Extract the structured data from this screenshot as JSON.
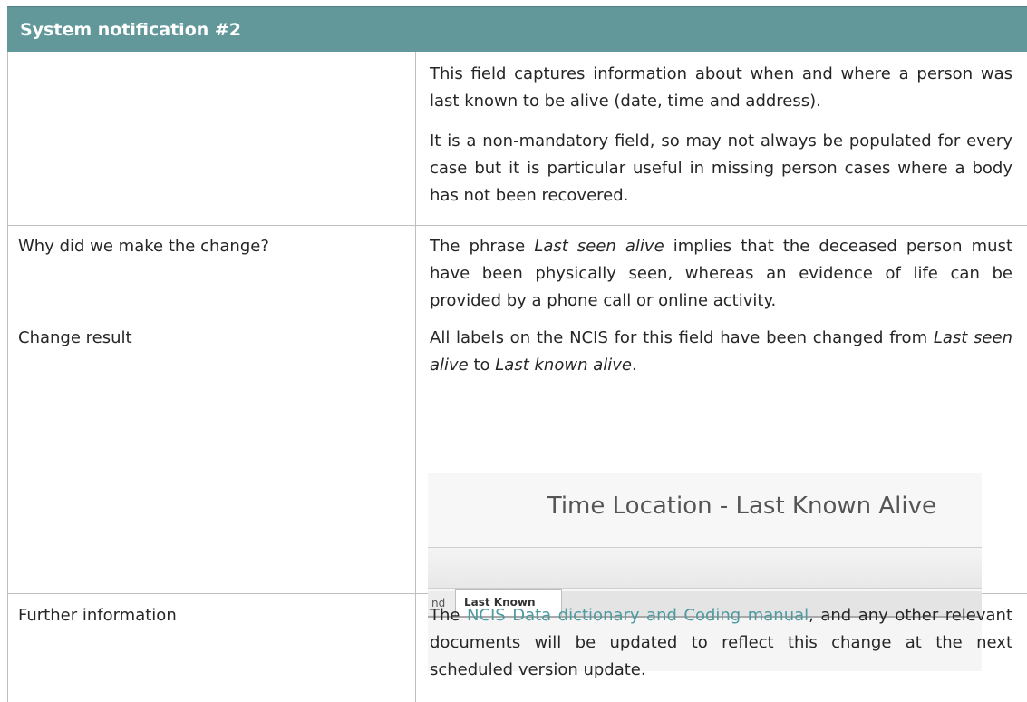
{
  "header": {
    "title": "System notification #2"
  },
  "rows": {
    "intro": {
      "p1": "This field captures information about when and where a person was last known to be alive (date, time and address).",
      "p2": "It is a non-mandatory field, so may not always be populated for every case but it is particular useful in missing person cases where a body has not been recovered."
    },
    "why": {
      "label": "Why did we make the change?",
      "text_a": "The phrase ",
      "text_em": "Last seen alive",
      "text_b": " implies that the deceased person must have been physically seen, whereas an evidence of life can be provided by a phone call or online activity."
    },
    "result": {
      "label": "Change result",
      "text_a": "All labels on the NCIS for this field have been changed from ",
      "text_em1": "Last seen alive",
      "text_b": " to ",
      "text_em2": "Last known alive",
      "text_c": "."
    },
    "further": {
      "label": "Further information",
      "text_a": "The ",
      "link": "NCIS Data dictionary and Coding manual",
      "text_b": ", and any other relevant documents will be updated to reflect this change at the next scheduled version update."
    }
  },
  "screenshot": {
    "title": "Time Location - Last Known Alive",
    "prev_tab": "nd",
    "active_tab": "Last Known Alive"
  }
}
